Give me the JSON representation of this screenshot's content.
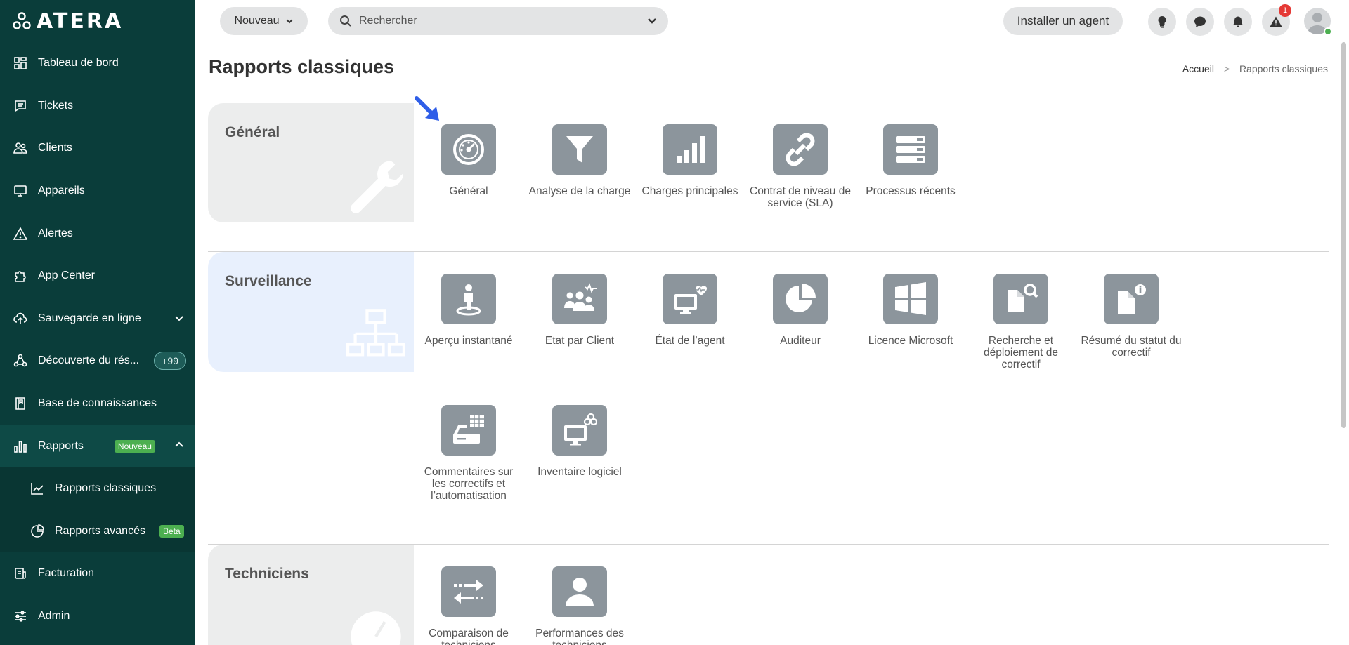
{
  "brand": {
    "name": "ATERA"
  },
  "sidebar": {
    "items": [
      {
        "label": "Tableau de bord"
      },
      {
        "label": "Tickets"
      },
      {
        "label": "Clients"
      },
      {
        "label": "Appareils"
      },
      {
        "label": "Alertes"
      },
      {
        "label": "App Center"
      },
      {
        "label": "Sauvegarde en ligne"
      },
      {
        "label": "Découverte du rés...",
        "count": "+99"
      },
      {
        "label": "Base de connaissances"
      },
      {
        "label": "Rapports",
        "badge": "Nouveau"
      },
      {
        "label": "Rapports classiques"
      },
      {
        "label": "Rapports avancés",
        "badge": "Beta"
      },
      {
        "label": "Facturation"
      },
      {
        "label": "Admin"
      }
    ]
  },
  "topbar": {
    "new_label": "Nouveau",
    "search_placeholder": "Rechercher",
    "install_label": "Installer un agent",
    "alert_count": "1"
  },
  "page": {
    "title": "Rapports classiques",
    "breadcrumb": {
      "home": "Accueil",
      "sep": ">",
      "current": "Rapports classiques"
    }
  },
  "sections": {
    "general": {
      "title": "Général",
      "tiles": [
        {
          "label": "Général"
        },
        {
          "label": "Analyse de la charge"
        },
        {
          "label": "Charges principales"
        },
        {
          "label": "Contrat de niveau de service (SLA)"
        },
        {
          "label": "Processus récents"
        }
      ]
    },
    "surveillance": {
      "title": "Surveillance",
      "tiles": [
        {
          "label": "Aperçu instantané"
        },
        {
          "label": "Etat par Client"
        },
        {
          "label": "État de l’agent"
        },
        {
          "label": "Auditeur"
        },
        {
          "label": "Licence Microsoft"
        },
        {
          "label": "Recherche et déploiement de correctif"
        },
        {
          "label": "Résumé du statut du correctif"
        },
        {
          "label": "Commentaires sur les correctifs et l’automatisation"
        },
        {
          "label": "Inventaire logiciel"
        }
      ]
    },
    "techniciens": {
      "title": "Techniciens",
      "tiles": [
        {
          "label": "Comparaison de techniciens"
        },
        {
          "label": "Performances des techniciens"
        }
      ]
    }
  },
  "colors": {
    "sidebar_bg": "#0a3d3a",
    "tile_bg": "#8c959c",
    "accent_arrow": "#2f5ee8",
    "badge_green": "#4caf50"
  }
}
